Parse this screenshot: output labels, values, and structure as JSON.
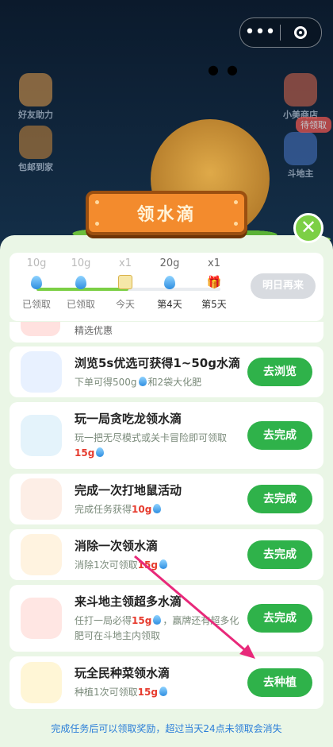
{
  "colors": {
    "accent_green": "#2fb24a",
    "highlight_red": "#e63b2e",
    "drop_blue": "#2f8ee0",
    "banner_orange": "#f38b2d"
  },
  "background": {
    "left_items": [
      {
        "label": "好友助力",
        "icon": "friends-icon"
      },
      {
        "label": "包邮到家",
        "icon": "shopping-bag-icon"
      }
    ],
    "right_items": [
      {
        "label": "小美商店",
        "icon": "store-icon"
      },
      {
        "label": "斗地主",
        "icon": "playing-cards-icon"
      }
    ],
    "right_badge": "待领取"
  },
  "capsule": {
    "more_icon": "more-dots-icon",
    "close_icon": "target-icon"
  },
  "panel": {
    "title": "领水滴",
    "close_icon": "close-icon"
  },
  "progress": {
    "filled_fraction": 0.5,
    "nodes": [
      {
        "amount": "10g",
        "label": "已领取",
        "icon": "water-drop-icon"
      },
      {
        "amount": "10g",
        "label": "已领取",
        "icon": "water-drop-icon"
      },
      {
        "amount": "x1",
        "label": "今天",
        "icon": "calendar-icon"
      },
      {
        "amount": "20g",
        "label": "第4天",
        "icon": "water-drop-icon"
      },
      {
        "amount": "x1",
        "label": "第5天",
        "icon": "gift-icon"
      }
    ],
    "button": "明日再来"
  },
  "partial_task": {
    "desc": "精选优惠"
  },
  "tasks": [
    {
      "title": "浏览5s优选可获得1~50g水滴",
      "desc_a": "下单可得500g",
      "desc_b": "和2袋大化肥",
      "desc_c": "",
      "button": "去浏览",
      "icon": "coupon-icon"
    },
    {
      "title": "玩一局贪吃龙领水滴",
      "desc_a": "玩一把无尽模式或关卡冒险即可领取",
      "highlight": "15g",
      "desc_c": "",
      "button": "去完成",
      "icon": "snake-icon"
    },
    {
      "title": "完成一次打地鼠活动",
      "desc_a": "完成任务获得",
      "highlight": "10g",
      "desc_c": "",
      "button": "去完成",
      "icon": "mole-icon"
    },
    {
      "title": "消除一次领水滴",
      "desc_a": "消除1次可领取",
      "highlight": "15g",
      "desc_c": "",
      "button": "去完成",
      "icon": "match-blocks-icon"
    },
    {
      "title": "来斗地主领超多水滴",
      "desc_a": "任打一局必得",
      "highlight": "15g",
      "desc_c": "，赢牌还有超多化肥可在斗地主内领取",
      "button": "去完成",
      "icon": "red-envelope-icon"
    },
    {
      "title": "玩全民种菜领水滴",
      "desc_a": "种植1次可领取",
      "highlight": "15g",
      "desc_c": "",
      "button": "去种植",
      "icon": "flower-pot-icon"
    }
  ],
  "footer": "完成任务后可以领取奖励，超过当天24点未领取会消失"
}
